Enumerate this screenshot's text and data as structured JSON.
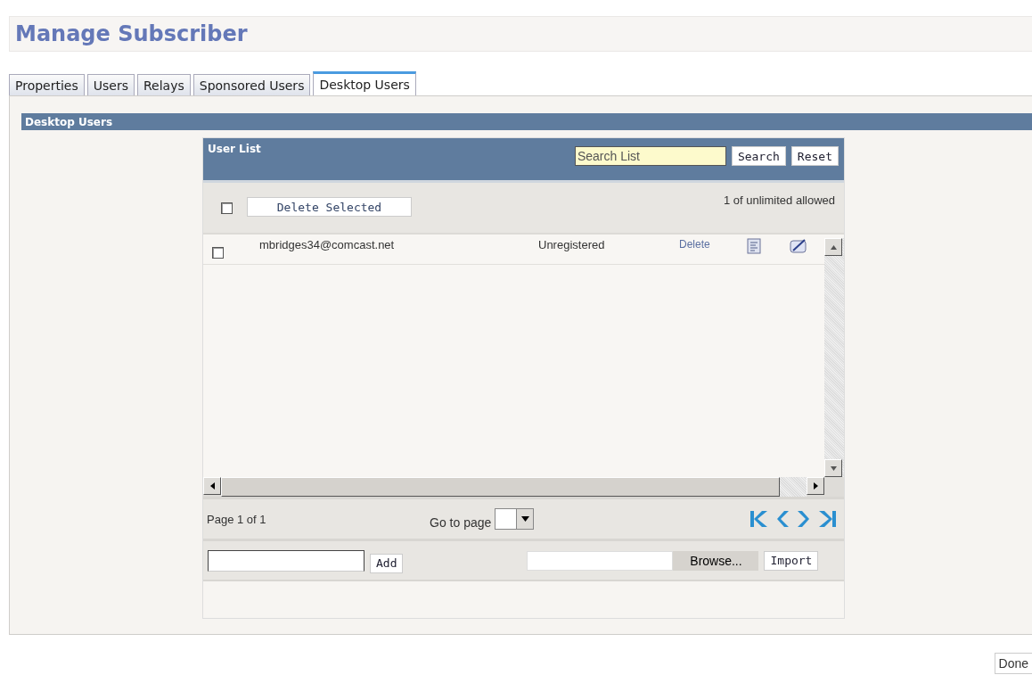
{
  "page_title": "Manage Subscriber",
  "tabs": [
    {
      "label": "Properties",
      "selected": false
    },
    {
      "label": "Users",
      "selected": false
    },
    {
      "label": "Relays",
      "selected": false
    },
    {
      "label": "Sponsored Users",
      "selected": false
    },
    {
      "label": "Desktop Users",
      "selected": true
    }
  ],
  "section_title": "Desktop Users",
  "user_list": {
    "title": "User List",
    "search": {
      "placeholder": "Search List"
    },
    "search_button": "Search",
    "reset_button": "Reset",
    "select_all_checked": false,
    "delete_selected_button": "Delete Selected",
    "allowance": "1 of unlimited allowed",
    "rows": [
      {
        "email": "mbridges34@comcast.net",
        "status": "Unregistered",
        "delete_link": "Delete",
        "checked": false
      }
    ],
    "pagination": {
      "page_label": "Page 1 of 1",
      "goto_label": "Go to page"
    },
    "add_button": "Add",
    "browse_button": "Browse...",
    "import_button": "Import"
  },
  "done_button": "Done"
}
